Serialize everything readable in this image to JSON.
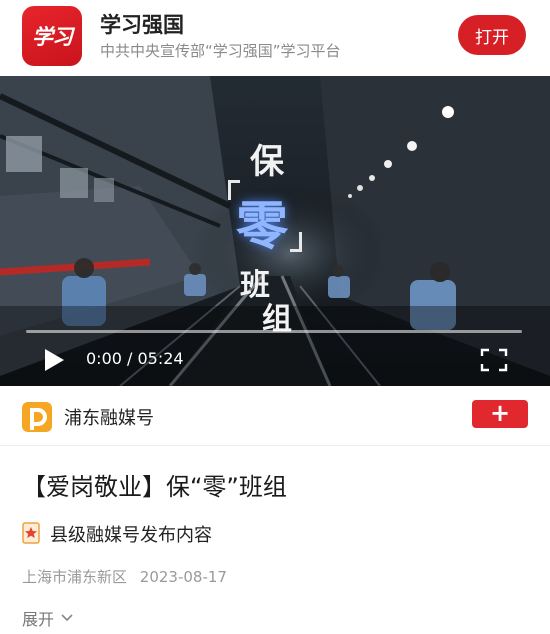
{
  "app": {
    "logo_text": "学习",
    "name": "学习强国",
    "description": "中共中央宣传部“学习强国”学习平台",
    "open_label": "打开"
  },
  "video": {
    "overlay_title": {
      "char1": "保",
      "char2": "零",
      "char3": "班",
      "char4": "组"
    },
    "time": "0:00 / 05:24",
    "progress": 0
  },
  "source": {
    "name": "浦东融媒号",
    "follow_label": "+"
  },
  "article": {
    "title": "【爱岗敬业】保“零”班组",
    "badge_text": "县级融媒号发布内容",
    "location": "上海市浦东新区",
    "date": "2023-08-17",
    "expand_label": "展开"
  },
  "colors": {
    "brand_red": "#d71f26",
    "source_orange": "#f5a623"
  }
}
